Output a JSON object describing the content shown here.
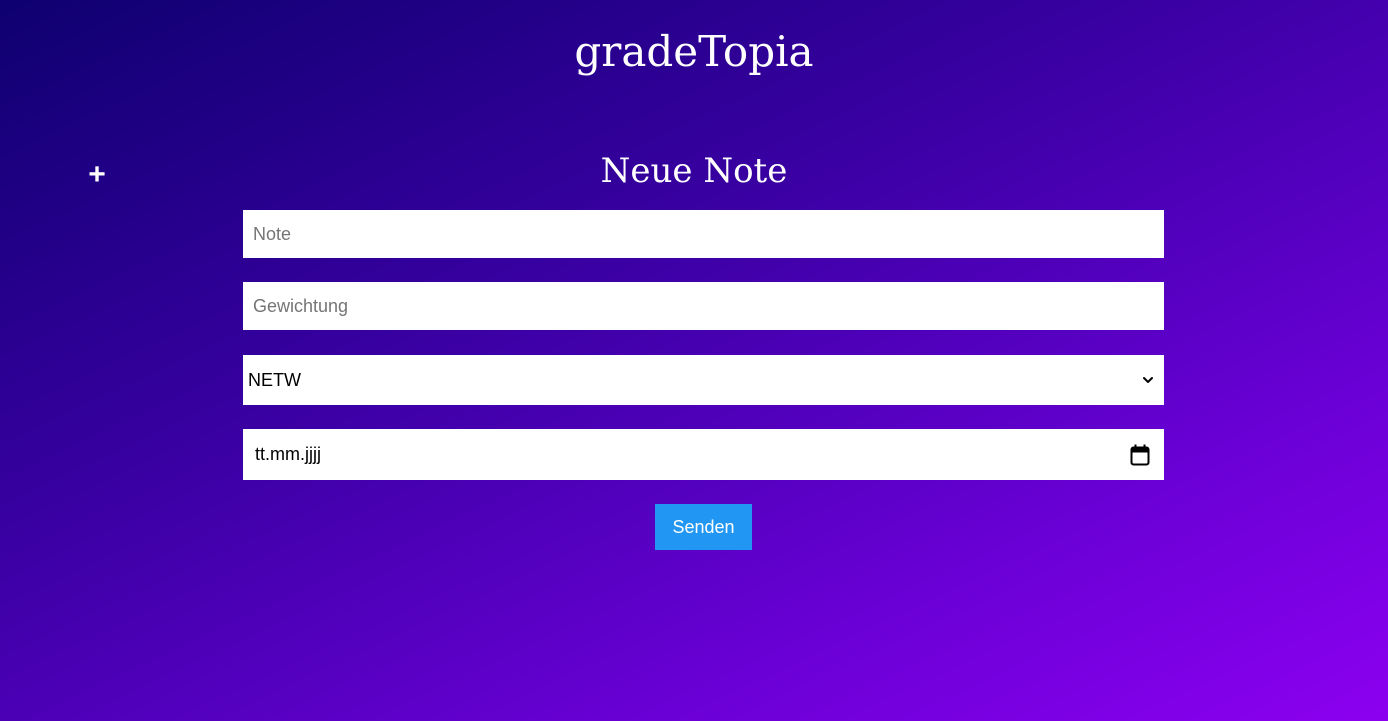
{
  "app": {
    "title": "gradeTopia"
  },
  "toolbar": {
    "add_label": "+"
  },
  "form": {
    "title": "Neue Note",
    "note": {
      "placeholder": "Note",
      "value": ""
    },
    "weight": {
      "placeholder": "Gewichtung",
      "value": ""
    },
    "subject": {
      "selected": "NETW"
    },
    "date": {
      "display": "tt.mm.jjjj"
    },
    "submit_label": "Senden"
  },
  "colors": {
    "gradient_start": "#0e0070",
    "gradient_end": "#8c00f0",
    "button": "#2196f3",
    "text": "#ffffff"
  },
  "icons": {
    "add": "plus-icon",
    "select": "chevron-down-icon",
    "date": "calendar-icon"
  }
}
